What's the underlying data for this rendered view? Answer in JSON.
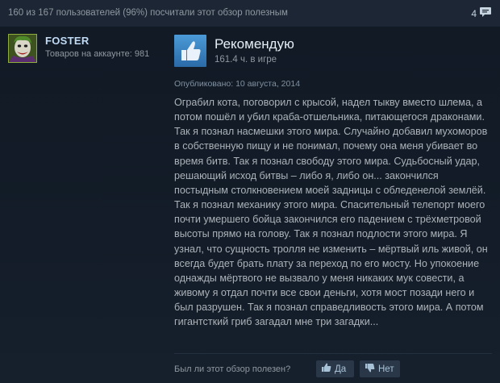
{
  "header": {
    "helpful_summary": "160 из 167 пользователей (96%) посчитали этот обзор полезным",
    "comment_count": "4"
  },
  "author": {
    "name": "FOSTER",
    "games_owned": "Товаров на аккаунте: 981"
  },
  "review": {
    "verdict": "Рекомендую",
    "hours": "161.4 ч. в игре",
    "posted": "Опубликовано: 10 августа, 2014",
    "text": "Ограбил кота, поговорил с крысой, надел тыкву вместо шлема, а потом пошёл и убил краба-отшельника, питающегося драконами. Так я познал насмешки этого мира. Случайно добавил мухоморов в собственную пищу и не понимал, почему она меня убивает во время битв. Так я познал свободу этого мира. Судьбосный удар, решающий исход битвы – либо я, либо он... закончился постыдным столкновением моей задницы с обледенелой землёй. Так я познал механику этого мира. Спасительный телепорт моего почти умершего бойца закончился его падением с трёхметровой высоты прямо на голову. Так я познал подлости этого мира. Я узнал, что сущность тролля не изменить – мёртвый иль живой, он всегда будет брать плату за переход по его мосту. Но упокоение однажды мёртвого не вызвало у меня никаких мук совести, а живому я отдал почти все свои деньги, хотя мост позади него и был разрушен. Так я познал справедливость этого мира. А потом гигантсткий гриб загадал мне три загадки..."
  },
  "vote": {
    "question": "Был ли этот обзор полезен?",
    "yes_label": "Да",
    "no_label": "Нет"
  },
  "icons": {
    "comment": "speech-bubble-icon",
    "recommend": "thumbs-up-icon",
    "vote_yes": "thumbs-up-icon",
    "vote_no": "thumbs-down-icon"
  },
  "colors": {
    "background": "#16202d",
    "author_name": "#c1dbf4",
    "thumb_badge": "#3d85c6",
    "body_text": "#acb2b8",
    "vote_button": "#2a3749"
  }
}
